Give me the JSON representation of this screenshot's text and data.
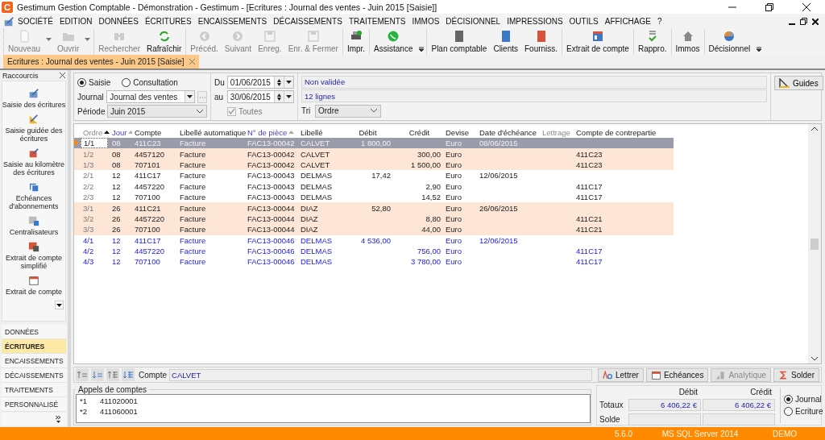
{
  "window": {
    "logo": "C",
    "title": "Gestimum Gestion Comptable - Démonstration - Gestimum - [Ecritures : Journal des ventes - Juin 2015 [Saisie]]"
  },
  "menu": [
    "SOCIÉTÉ",
    "EDITION",
    "DONNÉES",
    "ÉCRITURES",
    "ENCAISSEMENTS",
    "DÉCAISSEMENTS",
    "TRAITEMENTS",
    "IMMOS",
    "DÉCISIONNEL",
    "IMPRESSIONS",
    "OUTILS",
    "AFFICHAGE",
    "?"
  ],
  "toolbar": [
    {
      "label": "Nouveau",
      "disabled": true,
      "dropdown": true
    },
    {
      "label": "Ouvrir",
      "disabled": true,
      "dropdown": true
    },
    {
      "label": "Rechercher",
      "disabled": true,
      "dropdown": false
    },
    {
      "label": "Rafraîchir",
      "disabled": false,
      "dropdown": false
    },
    {
      "label": "Précéd.",
      "disabled": true,
      "dropdown": false
    },
    {
      "label": "Suivant",
      "disabled": true,
      "dropdown": false
    },
    {
      "label": "Enreg.",
      "disabled": true,
      "dropdown": false
    },
    {
      "label": "Enr. & Fermer",
      "disabled": true,
      "dropdown": false
    },
    {
      "label": "Impr.",
      "disabled": false,
      "dropdown": false
    },
    {
      "label": "Assistance",
      "disabled": false,
      "dropdown": false
    }
  ],
  "toolbar_2": [
    "Plan comptable",
    "Clients",
    "Fourniss.",
    "Extrait de compte",
    "Rappro.",
    "Immos",
    "Décisionnel"
  ],
  "document_tab": {
    "label": "Ecritures : Journal des ventes - Juin 2015 [Saisie]",
    "selected": true
  },
  "sidebar": {
    "title": "Raccourcis",
    "shortcuts": [
      "Saisie des écritures",
      "Saisie guidée des écritures",
      "Saisie au kilomètre des écritures",
      "Echéances d'abonnements",
      "Centralisateurs",
      "Extrait de compte simplifié",
      "Extrait de compte"
    ],
    "sections": [
      {
        "label": "DONNÉES",
        "selected": false
      },
      {
        "label": "ÉCRITURES",
        "selected": true
      },
      {
        "label": "ENCAISSEMENTS",
        "selected": false
      },
      {
        "label": "DÉCAISSEMENTS",
        "selected": false
      },
      {
        "label": "TRAITEMENTS",
        "selected": false
      },
      {
        "label": "PERSONNALISÉ",
        "selected": false
      }
    ]
  },
  "form": {
    "modes": [
      {
        "label": "Saisie",
        "selected": true
      },
      {
        "label": "Consultation",
        "selected": false
      }
    ],
    "journal_label": "Journal",
    "journal": "Journal des ventes",
    "periode_label": "Période",
    "periode": "Juin 2015",
    "du_label": "Du",
    "du": "01/06/2015",
    "au_label": "au",
    "au": "30/06/2015",
    "toutes": {
      "label": "Toutes",
      "checked": true,
      "disabled": true
    },
    "status": "Non validée",
    "lines": "12 lignes",
    "tri_label": "Tri",
    "tri": "Ordre",
    "guides_button": "Guides"
  },
  "table": {
    "columns": [
      {
        "label": "Ordre",
        "kind": "primary-sort"
      },
      {
        "label": "Jour",
        "kind": "linked-sort"
      },
      {
        "label": "Compte",
        "kind": "plain"
      },
      {
        "label": "Libellé automatique",
        "kind": "plain"
      },
      {
        "label": "N° de pièce",
        "kind": "linked-sort"
      },
      {
        "label": "Libellé",
        "kind": "plain"
      },
      {
        "label": "Débit",
        "kind": "plain"
      },
      {
        "label": "Crédit",
        "kind": "plain"
      },
      {
        "label": "Devise",
        "kind": "plain"
      },
      {
        "label": "Date d'échéance",
        "kind": "plain"
      },
      {
        "label": "Lettrage",
        "kind": "muted"
      },
      {
        "label": "Compte de contrepartie",
        "kind": "plain"
      }
    ],
    "rows": [
      {
        "kind": "posted",
        "selected": true,
        "highlighted": true,
        "ordre": "1/1",
        "jour": "08",
        "compte": "411C23",
        "libelle_automatique": "Facture",
        "numero_piece": "FAC13-00042",
        "libelle": "CALVET",
        "debit": "1 800,00",
        "devise": "Euro",
        "date_echeance": "08/06/2015"
      },
      {
        "kind": "posted",
        "selected": false,
        "highlighted": true,
        "ordre": "1/2",
        "jour": "08",
        "compte": "4457120",
        "libelle_automatique": "Facture",
        "numero_piece": "FAC13-00042",
        "libelle": "CALVET",
        "credit": "300,00",
        "devise": "Euro",
        "compte_contrepartie": "411C23"
      },
      {
        "kind": "posted",
        "selected": false,
        "highlighted": true,
        "ordre": "1/3",
        "jour": "08",
        "compte": "707101",
        "libelle_automatique": "Facture",
        "numero_piece": "FAC13-00042",
        "libelle": "CALVET",
        "credit": "1 500,00",
        "devise": "Euro",
        "compte_contrepartie": "411C23"
      },
      {
        "kind": "posted",
        "selected": false,
        "highlighted": false,
        "ordre": "2/1",
        "jour": "12",
        "compte": "411C17",
        "libelle_automatique": "Facture",
        "numero_piece": "FAC13-00043",
        "libelle": "DELMAS",
        "debit": "17,42",
        "devise": "Euro",
        "date_echeance": "12/06/2015"
      },
      {
        "kind": "posted",
        "selected": false,
        "highlighted": false,
        "ordre": "2/2",
        "jour": "12",
        "compte": "4457220",
        "libelle_automatique": "Facture",
        "numero_piece": "FAC13-00043",
        "libelle": "DELMAS",
        "credit": "2,90",
        "devise": "Euro",
        "compte_contrepartie": "411C17"
      },
      {
        "kind": "posted",
        "selected": false,
        "highlighted": false,
        "ordre": "2/3",
        "jour": "12",
        "compte": "707100",
        "libelle_automatique": "Facture",
        "numero_piece": "FAC13-00043",
        "libelle": "DELMAS",
        "credit": "14,52",
        "devise": "Euro",
        "compte_contrepartie": "411C17"
      },
      {
        "kind": "posted",
        "selected": false,
        "highlighted": true,
        "ordre": "3/1",
        "jour": "26",
        "compte": "411C21",
        "libelle_automatique": "Facture",
        "numero_piece": "FAC13-00044",
        "libelle": "DIAZ",
        "debit": "52,80",
        "devise": "Euro",
        "date_echeance": "26/06/2015"
      },
      {
        "kind": "posted",
        "selected": false,
        "highlighted": true,
        "ordre": "3/2",
        "jour": "26",
        "compte": "4457220",
        "libelle_automatique": "Facture",
        "numero_piece": "FAC13-00044",
        "libelle": "DIAZ",
        "credit": "8,80",
        "devise": "Euro",
        "compte_contrepartie": "411C21"
      },
      {
        "kind": "posted",
        "selected": false,
        "highlighted": true,
        "ordre": "3/3",
        "jour": "26",
        "compte": "707100",
        "libelle_automatique": "Facture",
        "numero_piece": "FAC13-00044",
        "libelle": "DIAZ",
        "credit": "44,00",
        "devise": "Euro",
        "compte_contrepartie": "411C21"
      },
      {
        "kind": "new",
        "selected": false,
        "highlighted": false,
        "ordre": "4/1",
        "jour": "12",
        "compte": "411C17",
        "libelle_automatique": "Facture",
        "numero_piece": "FAC13-00046",
        "libelle": "DELMAS",
        "debit": "4 536,00",
        "devise": "Euro",
        "date_echeance": "12/06/2015"
      },
      {
        "kind": "new",
        "selected": false,
        "highlighted": false,
        "ordre": "4/2",
        "jour": "12",
        "compte": "4457220",
        "libelle_automatique": "Facture",
        "numero_piece": "FAC13-00046",
        "libelle": "DELMAS",
        "credit": "756,00",
        "devise": "Euro",
        "compte_contrepartie": "411C17"
      },
      {
        "kind": "new",
        "selected": false,
        "highlighted": false,
        "ordre": "4/3",
        "jour": "12",
        "compte": "707100",
        "libelle_automatique": "Facture",
        "numero_piece": "FAC13-00046",
        "libelle": "DELMAS",
        "credit": "3 780,00",
        "devise": "Euro",
        "compte_contrepartie": "411C17"
      }
    ]
  },
  "grid_toolbar": {
    "compte_label": "Compte",
    "compte": "CALVET",
    "buttons": [
      {
        "label": "Lettrer",
        "disabled": false
      },
      {
        "label": "Echéances",
        "disabled": false
      },
      {
        "label": "Analytique",
        "disabled": true
      },
      {
        "label": "Solder",
        "disabled": false
      }
    ]
  },
  "appels": {
    "title": "Appels de comptes",
    "items": [
      {
        "key": "*1",
        "account": "411020001"
      },
      {
        "key": "*2",
        "account": "411060001"
      }
    ]
  },
  "totals": {
    "debit_label": "Débit",
    "credit_label": "Crédit",
    "totaux_label": "Totaux",
    "totaux_debit": "6 406,22 €",
    "totaux_credit": "6 406,22 €",
    "solde_label": "Solde",
    "views": [
      {
        "label": "Journal",
        "selected": true
      },
      {
        "label": "Ecriture",
        "selected": false
      }
    ]
  },
  "status_bar": [
    "5.6.0",
    "MS SQL Server 2014",
    "DEMO"
  ]
}
